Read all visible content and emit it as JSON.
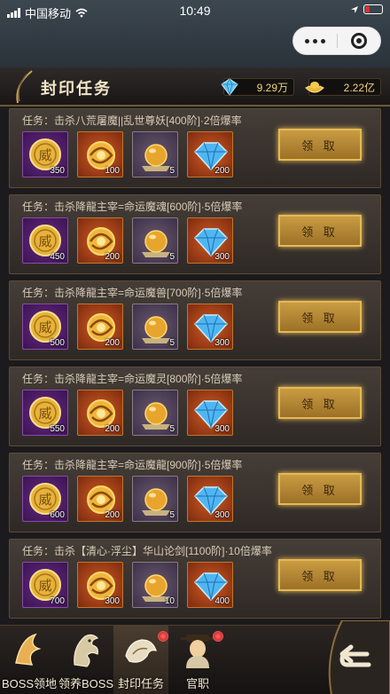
{
  "status": {
    "carrier": "中国移动",
    "time": "10:49"
  },
  "header": {
    "title": "封印任务",
    "diamonds": "9.29万",
    "gold": "2.22亿"
  },
  "claim_label": "领 取",
  "tasks": [
    {
      "text": "任务：击杀八荒屠魔||乱世尊妖[400阶]·2倍爆率",
      "counts": [
        "350",
        "100",
        "5",
        "200"
      ]
    },
    {
      "text": "任务：击杀降龍主宰=命运魔魂[600阶]·5倍爆率",
      "counts": [
        "450",
        "200",
        "5",
        "300"
      ]
    },
    {
      "text": "任务：击杀降龍主宰=命运魔兽[700阶]·5倍爆率",
      "counts": [
        "500",
        "200",
        "5",
        "300"
      ]
    },
    {
      "text": "任务：击杀降龍主宰=命运魔灵[800阶]·5倍爆率",
      "counts": [
        "550",
        "200",
        "5",
        "300"
      ]
    },
    {
      "text": "任务：击杀降龍主宰=命运魔龍[900阶]·5倍爆率",
      "counts": [
        "600",
        "200",
        "5",
        "300"
      ]
    },
    {
      "text": "任务：击杀【清心·浮尘】华山论剑[1100阶]·10倍爆率",
      "counts": [
        "700",
        "300",
        "10",
        "400"
      ]
    }
  ],
  "nav": [
    {
      "label": "BOSS领地",
      "icon": "boss-land-icon"
    },
    {
      "label": "领养BOSS",
      "icon": "dragon-icon"
    },
    {
      "label": "封印任务",
      "icon": "seal-icon",
      "active": true,
      "badge": true
    },
    {
      "label": "官职",
      "icon": "official-icon",
      "badge": true
    }
  ],
  "colors": {
    "accent": "#e3b954",
    "badge": "#d42020",
    "text": "#d8ccb8"
  }
}
